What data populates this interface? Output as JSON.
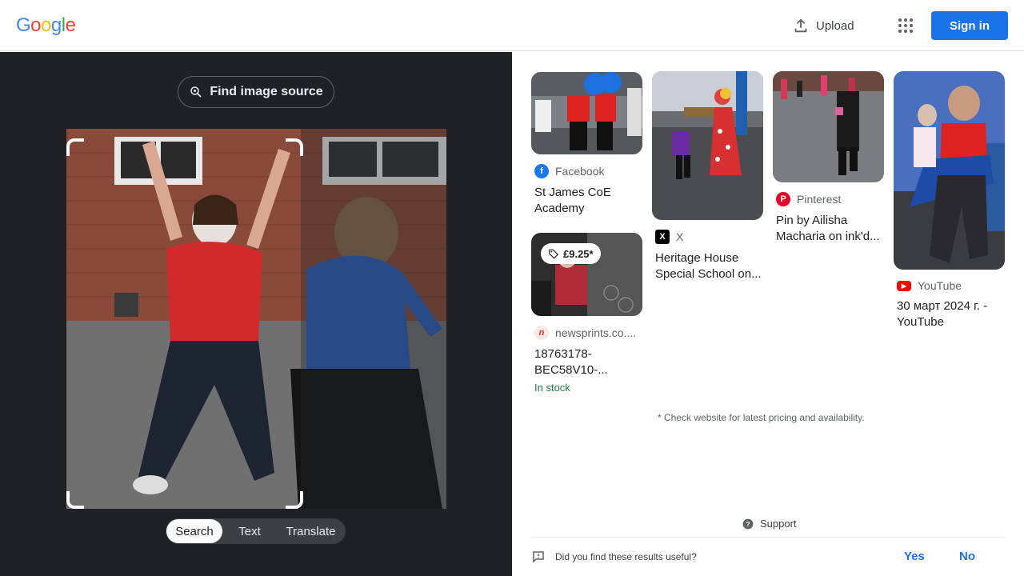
{
  "header": {
    "logo": [
      "G",
      "o",
      "o",
      "g",
      "l",
      "e"
    ],
    "logo_colors": [
      "#4285f4",
      "#ea4335",
      "#fbbc05",
      "#4285f4",
      "#34a853",
      "#ea4335"
    ],
    "upload_label": "Upload",
    "signin_label": "Sign in",
    "accent": "#1a73e8"
  },
  "left": {
    "find_source_label": "Find image source",
    "modes": [
      "Search",
      "Text",
      "Translate"
    ],
    "active_mode": "Search"
  },
  "results": [
    {
      "source": "Facebook",
      "source_icon": "facebook-icon",
      "source_color": "#1877f2",
      "title_lines": [
        "St James CoE",
        "Academy"
      ]
    },
    {
      "source": "newsprints.co....",
      "source_icon": "newsprints-icon",
      "source_color": "#e8eaed",
      "title_lines": [
        "18763178-",
        "BEC58V10-..."
      ],
      "price": "£9.25*",
      "stock": "In stock"
    },
    {
      "source": "X",
      "source_icon": "x-icon",
      "source_color": "#000000",
      "title_lines": [
        "Heritage House",
        "Special School on..."
      ]
    },
    {
      "source": "Pinterest",
      "source_icon": "pinterest-icon",
      "source_color": "#e60023",
      "title_lines": [
        "Pin by Ailisha",
        "Macharia on ink'd..."
      ]
    },
    {
      "source": "YouTube",
      "source_icon": "youtube-icon",
      "source_color": "#ff0000",
      "title_lines": [
        "30 март 2024 г. -",
        "YouTube"
      ]
    }
  ],
  "note": "* Check website for latest pricing and availability.",
  "support_label": "Support",
  "feedback": {
    "question": "Did you find these results useful?",
    "yes": "Yes",
    "no": "No"
  }
}
